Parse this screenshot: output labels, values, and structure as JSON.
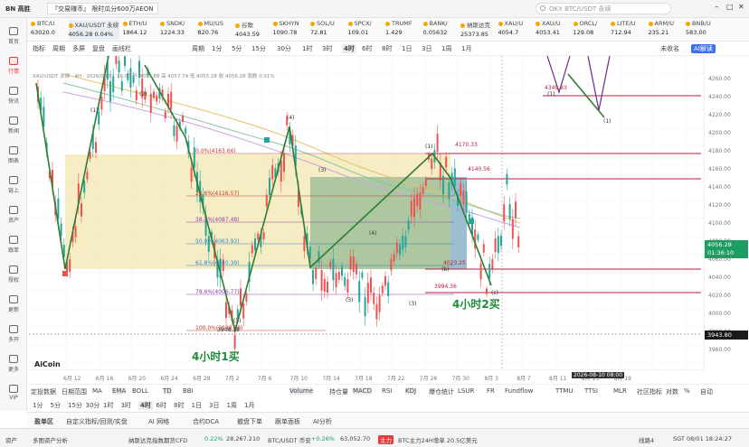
{
  "window": {
    "app_name": "BN 高胜",
    "tab_title": "『交易赚币』 限时瓜分600万AEON",
    "search_placeholder": "OKX BTC/USDT 永续"
  },
  "sidebar": [
    {
      "label": "首页",
      "icon": "home-icon"
    },
    {
      "label": "行情",
      "icon": "chart-icon",
      "active": true
    },
    {
      "label": "快讯",
      "icon": "flash-icon"
    },
    {
      "label": "新闻",
      "icon": "news-icon"
    },
    {
      "label": "图表",
      "icon": "chart-grid-icon"
    },
    {
      "label": "链上",
      "icon": "chain-icon"
    },
    {
      "label": "资产",
      "icon": "wallet-icon"
    },
    {
      "label": "跟单",
      "icon": "copy-icon"
    },
    {
      "label": "授权",
      "icon": "key-icon"
    },
    {
      "label": "更新",
      "icon": "refresh-icon"
    },
    {
      "label": "多开",
      "icon": "window-icon"
    },
    {
      "label": "更多",
      "icon": "more-icon"
    },
    {
      "label": "VIP",
      "icon": "vip-icon"
    }
  ],
  "tickers": [
    {
      "name": "BTC/U",
      "price": "63020.0"
    },
    {
      "name": "XAU/USDT 永续",
      "price": "4056.28 0.04%",
      "selected": true
    },
    {
      "name": "ETH/U",
      "price": "1864.12"
    },
    {
      "name": "SNDK/",
      "price": "1224.33"
    },
    {
      "name": "MU/US",
      "price": "820.76"
    },
    {
      "name": "谷歌",
      "price": "4043.59"
    },
    {
      "name": "SKHYN",
      "price": "1090.78"
    },
    {
      "name": "SOL/U",
      "price": "72.81"
    },
    {
      "name": "SPCX/",
      "price": "109.01"
    },
    {
      "name": "TRUMF",
      "price": "1.429"
    },
    {
      "name": "BANK/",
      "price": "0.05632"
    },
    {
      "name": "纳斯达克",
      "price": "25373.85"
    },
    {
      "name": "XAU/U",
      "price": "4054.7"
    },
    {
      "name": "XAU/U",
      "price": "4053.41"
    },
    {
      "name": "ORCL/",
      "price": "129.08"
    },
    {
      "name": "LITE/U",
      "price": "712.94"
    },
    {
      "name": "ARM/U",
      "price": "235.21"
    },
    {
      "name": "BNB/U",
      "price": "583.00"
    }
  ],
  "toolbar": {
    "items": [
      "指标",
      "周期",
      "多屏",
      "复盘",
      "画线栏",
      "周期",
      "1分",
      "5分",
      "15分",
      "30分",
      "1时",
      "3时",
      "4时",
      "6时",
      "8时",
      "1日",
      "3日",
      "1周",
      "1月"
    ],
    "active": "4时",
    "right": [
      "未收名",
      "AI解读"
    ]
  },
  "chart": {
    "info_line": "XAU/USDT 永续 · 4H · 2026/08/01 16:00 开 4056.88 高 4057.74 低 4055.28 收 4056.28 涨跌 0.01%",
    "fib_labels": [
      {
        "text": "0.0%(4163.66)",
        "color": "#c0392b"
      },
      {
        "text": "23.6%(4116.57)",
        "color": "#c0392b"
      },
      {
        "text": "38.2%(4087.48)",
        "color": "#8e44ad"
      },
      {
        "text": "50.0%(4063.93)",
        "color": "#2e86c1"
      },
      {
        "text": "61.8%(4040.39)",
        "color": "#2e86c1"
      },
      {
        "text": "78.6%(4006.77)",
        "color": "#8e44ad"
      },
      {
        "text": "100.0%(3948.18)",
        "color": "#c0392b"
      }
    ],
    "price_levels": [
      {
        "label": "4170.33"
      },
      {
        "label": "4140.56"
      },
      {
        "label": "4023.25"
      },
      {
        "label": "3994.36"
      },
      {
        "label": "4349.83"
      }
    ],
    "low_label": "3948.18",
    "annotation_1": "4小时1买",
    "annotation_2": "4小时2买",
    "watermark": "AiCoin",
    "wave_labels": [
      "(1)",
      "(2)",
      "(3)",
      "(4)",
      "(5)",
      "(a)",
      "(b)",
      "(c)"
    ],
    "current_price": "4056.28",
    "countdown": "01:36:10",
    "crosshair_price": "3943.80",
    "crosshair_date": "2026-08-10 08:00"
  },
  "y_axis": [
    "4260.00",
    "4240.00",
    "4220.00",
    "4200.00",
    "4180.00",
    "4160.00",
    "4140.00",
    "4120.00",
    "4100.00",
    "4080.00",
    "4060.00",
    "4040.00",
    "4020.00",
    "4000.00",
    "3980.00",
    "3960.00"
  ],
  "x_axis": [
    "6月 12",
    "6月 16",
    "6月 20",
    "6月 24",
    "6月 28",
    "7月 2",
    "7月 6",
    "7月 10",
    "7月 14",
    "7月 18",
    "7月 22",
    "7月 26",
    "7月 30",
    "8月 3",
    "8月 7",
    "8月 11",
    "8月 15",
    "8月 19"
  ],
  "indicator_bar": {
    "left": [
      "定投数据",
      "日期范围",
      "MA",
      "EMA",
      "BOLL",
      "TD",
      "BBI"
    ],
    "right": [
      "Volume",
      "持仓量",
      "MACD",
      "RSI",
      "KDJ",
      "爆仓统计",
      "LSUR",
      "FR",
      "Fundflow",
      "TTMU",
      "TTSI",
      "MLR",
      "社区指标",
      "对数",
      "%",
      "自动"
    ]
  },
  "tf_bar": [
    "1分",
    "5分",
    "15分",
    "30分",
    "1时",
    "3时",
    "4时",
    "6时",
    "8时",
    "1日",
    "3日",
    "1周",
    "1月"
  ],
  "tf_active": "4时",
  "bottom_nav": [
    "盈单区",
    "自定义指标/回测/实盘",
    "AI 网格",
    "合约DCA",
    "撤盘下单",
    "跟单面板",
    "AI分析"
  ],
  "status_bar": {
    "items": [
      "资产",
      "多图资产分析",
      "纳斯达克指数期货CFD",
      "0.22%",
      "28,267.210",
      "BTC/USDT 币安",
      "+0.26%",
      "63,052.70"
    ],
    "news_tag": "主力",
    "news": "BTC主力24H增单 20.5亿美元",
    "right": [
      "线路4",
      "SGT 08/01 18:24:27"
    ]
  },
  "colors": {
    "up": "#26a69a",
    "down": "#ef5350",
    "accent": "#e23b3b",
    "trend_line": "#2f7d32",
    "zone_yellow": "#f3e7b1",
    "zone_green": "#a7c7a4"
  }
}
